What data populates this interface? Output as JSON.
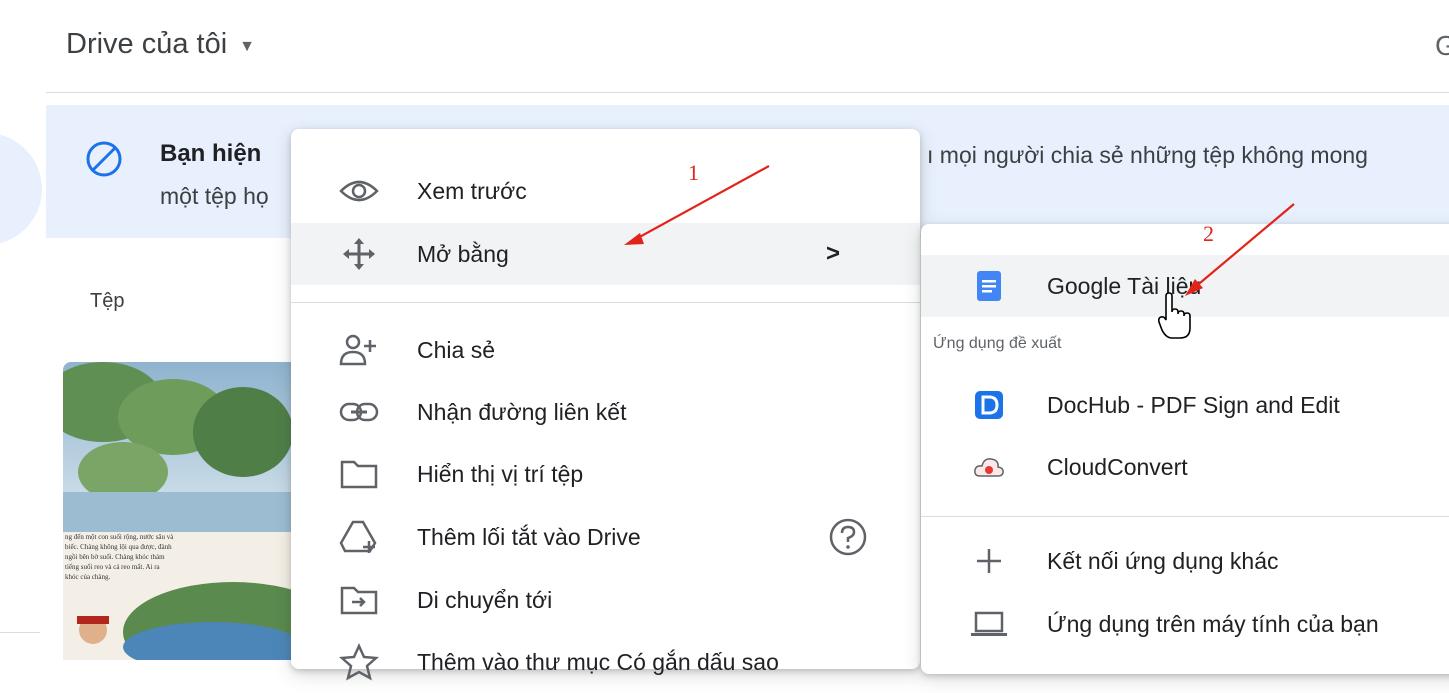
{
  "header": {
    "title": "Drive của tôi",
    "right_text": "G"
  },
  "banner": {
    "bold_text": "Bạn hiện",
    "continued_text": "ı mọi người chia sẻ những tệp không mong",
    "second_line": "một tệp họ"
  },
  "files_section": {
    "label": "Tệp"
  },
  "thumbnail": {
    "caption_lines": [
      "ng đến một con suối rộng, nước sâu và",
      "biếc. Chàng không lội qua được, đành",
      "ngồi bên bờ suối. Chàng khóc thảm",
      "tiếng suối reo và cả reo mất. Ai ra",
      "khóc của chàng."
    ]
  },
  "context_menu": {
    "items": [
      {
        "label": "Xem trước",
        "icon": "eye-icon"
      },
      {
        "label": "Mở bằng",
        "icon": "move-arrows-icon",
        "chevron": ">",
        "highlighted": true
      },
      {
        "label": "Chia sẻ",
        "icon": "add-person-icon"
      },
      {
        "label": "Nhận đường liên kết",
        "icon": "link-icon"
      },
      {
        "label": "Hiển thị vị trí tệp",
        "icon": "folder-icon"
      },
      {
        "label": "Thêm lối tắt vào Drive",
        "icon": "drive-shortcut-icon",
        "help_icon": "help-icon"
      },
      {
        "label": "Di chuyển tới",
        "icon": "move-to-folder-icon"
      },
      {
        "label": "Thêm vào thư mục Có gắn dấu sao",
        "icon": "star-icon"
      }
    ]
  },
  "submenu": {
    "items": [
      {
        "label": "Google Tài liệu",
        "icon": "google-docs-icon",
        "color": "#4285f4",
        "highlighted": true
      }
    ],
    "suggested_heading": "Ứng dụng đề xuất",
    "suggested": [
      {
        "label": "DocHub - PDF Sign and Edit",
        "icon": "dochub-icon",
        "color": "#1a73e8"
      },
      {
        "label": "CloudConvert",
        "icon": "cloudconvert-icon",
        "color": "#e53935"
      }
    ],
    "more": [
      {
        "label": "Kết nối ứng dụng khác",
        "icon": "plus-icon"
      },
      {
        "label": "Ứng dụng trên máy tính của bạn",
        "icon": "laptop-icon"
      }
    ]
  },
  "annotations": {
    "label_1": "1",
    "label_2": "2",
    "color": "#e2231a"
  },
  "colors": {
    "banner_bg": "#e8f0fe",
    "accent_blue": "#1a73e8",
    "highlight_bg": "#f1f3f4"
  }
}
